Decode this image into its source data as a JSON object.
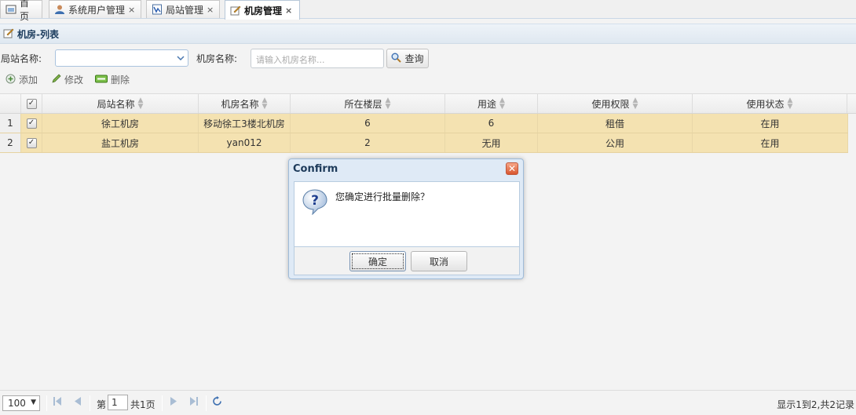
{
  "tabs": [
    {
      "label": "首页",
      "icon": "home-icon",
      "closable": false
    },
    {
      "label": "系统用户管理",
      "icon": "user-icon",
      "closable": true
    },
    {
      "label": "局站管理",
      "icon": "document-icon",
      "closable": true
    },
    {
      "label": "机房管理",
      "icon": "edit-icon",
      "closable": true,
      "active": true
    }
  ],
  "tab_close_glyph": "×",
  "panel": {
    "title": "机房-列表"
  },
  "search": {
    "station_label": "局站名称:",
    "room_label": "机房名称:",
    "room_placeholder": "请输入机房名称...",
    "query_label": "查询"
  },
  "toolbar": {
    "add": "添加",
    "edit": "修改",
    "delete": "删除"
  },
  "grid": {
    "columns": [
      "局站名称",
      "机房名称",
      "所在楼层",
      "用途",
      "使用权限",
      "使用状态"
    ],
    "rows": [
      {
        "num": "1",
        "cells": [
          "徐工机房",
          "移动徐工3楼北机房",
          "6",
          "6",
          "租借",
          "在用"
        ],
        "checked": true
      },
      {
        "num": "2",
        "cells": [
          "盐工机房",
          "yan012",
          "2",
          "无用",
          "公用",
          "在用"
        ],
        "checked": true
      }
    ]
  },
  "dialog": {
    "title": "Confirm",
    "message": "您确定进行批量删除？",
    "ok": "确定",
    "cancel": "取消"
  },
  "pager": {
    "page_size": "100",
    "page_prefix": "第",
    "current_page": "1",
    "total_pages": "共1页",
    "info": "显示1到2,共2记录"
  },
  "colors": {
    "accent": "#1a3a5c",
    "row_selected": "#f4e2b1",
    "panel_header": "#dfe8f1"
  }
}
